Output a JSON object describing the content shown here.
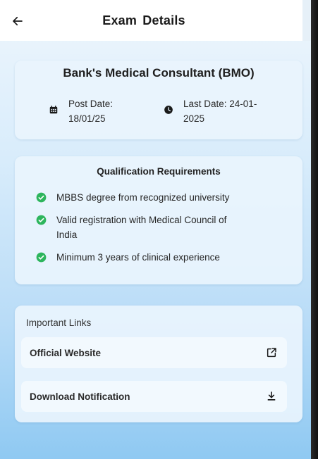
{
  "header": {
    "title": "Exam  Details",
    "back_icon": "arrow-left-icon"
  },
  "exam": {
    "name": "Bank's Medical Consultant (BMO)",
    "post_date_label": "Post Date:",
    "post_date_value": "18/01/25",
    "last_date_label": "Last Date: 24-01-",
    "last_date_value": "2025"
  },
  "qualifications": {
    "title": "Qualification Requirements",
    "items": [
      "MBBS degree from recognized university",
      "Valid registration with Medical Council of India",
      "Minimum 3 years of clinical experience"
    ]
  },
  "links": {
    "title": "Important Links",
    "official_website": "Official Website",
    "download_notification": "Download Notification"
  },
  "colors": {
    "check_green": "#2db55d",
    "accent": "#1a1a1a"
  }
}
